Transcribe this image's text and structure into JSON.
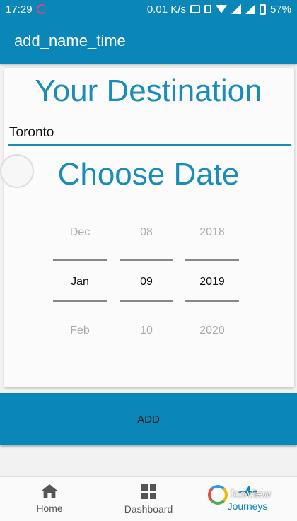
{
  "status_bar": {
    "time": "17:29",
    "speed": "0.01 K/s",
    "battery": "57%"
  },
  "app_bar": {
    "title": "add_name_time"
  },
  "destination": {
    "heading": "Your Destination",
    "value": "Toronto"
  },
  "date_picker": {
    "heading": "Choose Date",
    "month": {
      "prev": "Dec",
      "selected": "Jan",
      "next": "Feb"
    },
    "day": {
      "prev": "08",
      "selected": "09",
      "next": "10"
    },
    "year": {
      "prev": "2018",
      "selected": "2019",
      "next": "2020"
    }
  },
  "add_button": {
    "label": "ADD"
  },
  "bottom_nav": {
    "items": [
      {
        "label": "Home",
        "icon": "home-icon"
      },
      {
        "label": "Dashboard",
        "icon": "dashboard-icon"
      },
      {
        "label": "Journeys",
        "icon": "airplane-icon",
        "active": true
      }
    ]
  },
  "watermark": {
    "text": "fooView"
  },
  "colors": {
    "primary": "#0a86b8",
    "accent_text": "#1a8cba"
  }
}
